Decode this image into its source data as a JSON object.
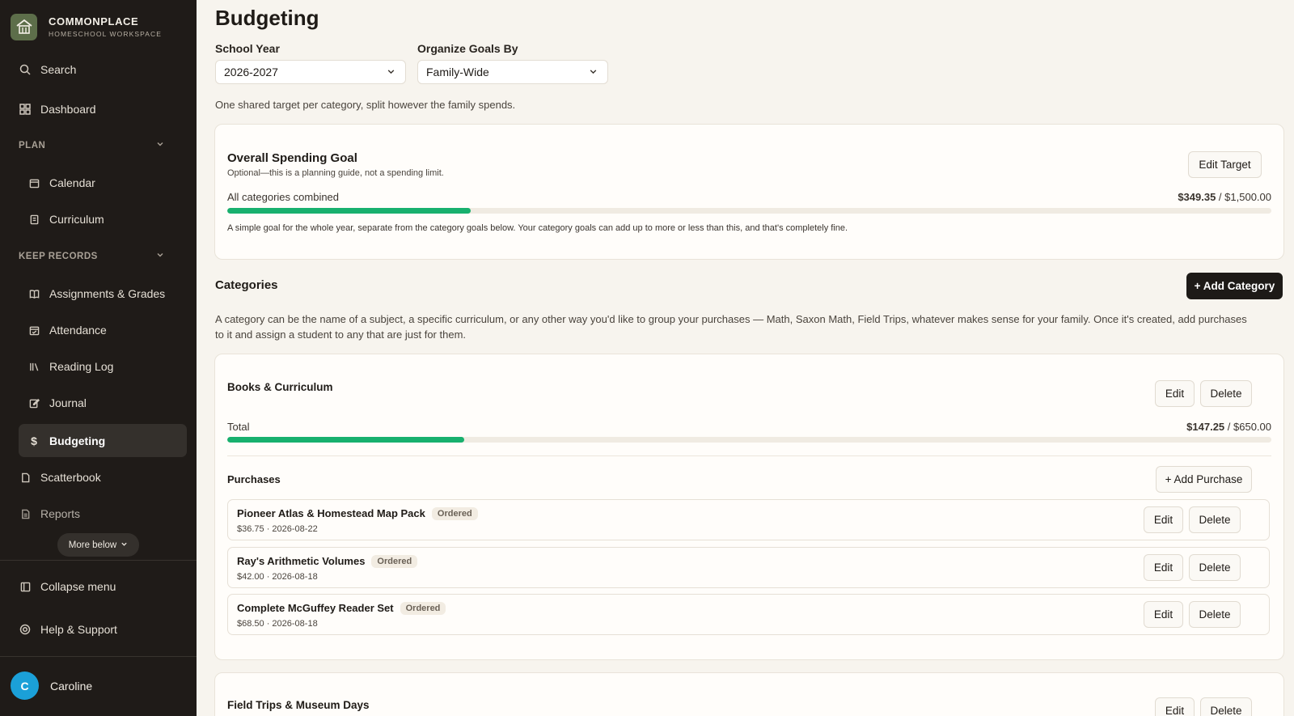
{
  "brand": {
    "name": "COMMONPLACE",
    "subtitle": "HOMESCHOOL WORKSPACE"
  },
  "sidebar": {
    "search": "Search",
    "dashboard": "Dashboard",
    "plan_section": "PLAN",
    "calendar": "Calendar",
    "curriculum": "Curriculum",
    "records_section": "KEEP RECORDS",
    "assignments": "Assignments & Grades",
    "attendance": "Attendance",
    "reading_log": "Reading Log",
    "journal": "Journal",
    "budgeting": "Budgeting",
    "scatterbook": "Scatterbook",
    "reports": "Reports",
    "more_below": "More below",
    "collapse": "Collapse menu",
    "help": "Help & Support"
  },
  "user": {
    "initial": "C",
    "name": "Caroline"
  },
  "page": {
    "title": "Budgeting",
    "school_year_label": "School Year",
    "school_year_value": "2026-2027",
    "organize_label": "Organize Goals By",
    "organize_value": "Family-Wide",
    "organize_hint": "One shared target per category, split however the family spends."
  },
  "overall": {
    "title": "Overall Spending Goal",
    "subtitle": "Optional—this is a planning guide, not a spending limit.",
    "edit_button": "Edit Target",
    "row_label": "All categories combined",
    "spent": "$349.35",
    "target": "$1,500.00",
    "progress": 0.233,
    "note": "A simple goal for the whole year, separate from the category goals below. Your category goals can add up to more or less than this, and that's completely fine."
  },
  "categories": {
    "heading": "Categories",
    "add_button": "+ Add Category",
    "description": "A category can be the name of a subject, a specific curriculum, or any other way you'd like to group your purchases — Math, Saxon Math, Field Trips, whatever makes sense for your family. Once it's created, add purchases to it and assign a student to any that are just for them.",
    "books": {
      "name": "Books & Curriculum",
      "edit": "Edit",
      "delete": "Delete",
      "total_label": "Total",
      "spent": "$147.25",
      "target": "$650.00",
      "progress": 0.227,
      "purchases_label": "Purchases",
      "add_purchase": "+ Add Purchase",
      "items": [
        {
          "name": "Pioneer Atlas & Homestead Map Pack",
          "status": "Ordered",
          "meta": "$36.75 · 2026-08-22",
          "edit": "Edit",
          "delete": "Delete"
        },
        {
          "name": "Ray's Arithmetic Volumes",
          "status": "Ordered",
          "meta": "$42.00 · 2026-08-18",
          "edit": "Edit",
          "delete": "Delete"
        },
        {
          "name": "Complete McGuffey Reader Set",
          "status": "Ordered",
          "meta": "$68.50 · 2026-08-18",
          "edit": "Edit",
          "delete": "Delete"
        }
      ]
    },
    "field_trips": {
      "name": "Field Trips & Museum Days",
      "edit": "Edit",
      "delete": "Delete"
    }
  },
  "colors": {
    "sidebar": "#1f1b18",
    "accent_green": "#18b06e",
    "avatar": "#1ba0d8",
    "background": "#f7f4ee"
  }
}
